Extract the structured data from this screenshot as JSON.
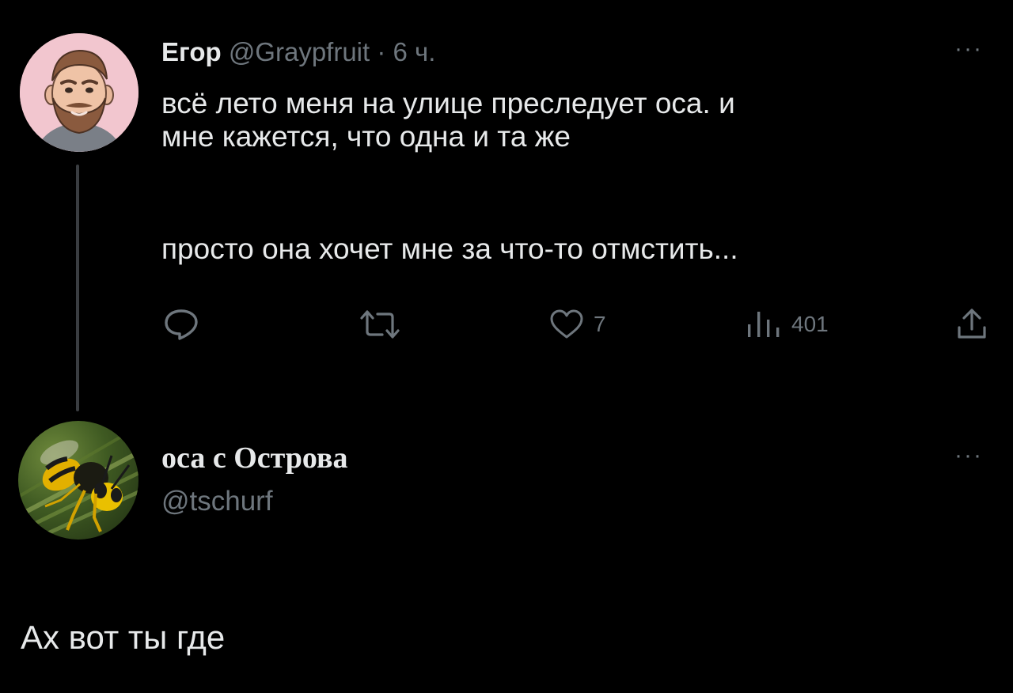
{
  "tweet": {
    "author_name": "Егор",
    "author_handle": "@Graypfruit",
    "separator": "·",
    "time": "6 ч.",
    "more_label": "···",
    "text_lines": [
      "всё лето меня на улице преследует оса. и",
      "мне кажется, что одна и та же"
    ],
    "text_line_2": "просто она хочет мне за что-то отмстить...",
    "actions": {
      "reply_count": "",
      "retweet_count": "",
      "like_count": "7",
      "views_count": "401"
    }
  },
  "reply": {
    "author_name": "оса с Острова",
    "author_handle": "@tschurf",
    "more_label": "···",
    "text": "Ах вот ты где"
  },
  "colors": {
    "background": "#000000",
    "text": "#e7e9ea",
    "muted": "#6e767d",
    "thread_line": "#3a3d41"
  },
  "icons": {
    "reply": "reply-icon",
    "retweet": "retweet-icon",
    "like": "heart-icon",
    "views": "views-icon",
    "share": "share-icon",
    "more": "more-icon"
  }
}
